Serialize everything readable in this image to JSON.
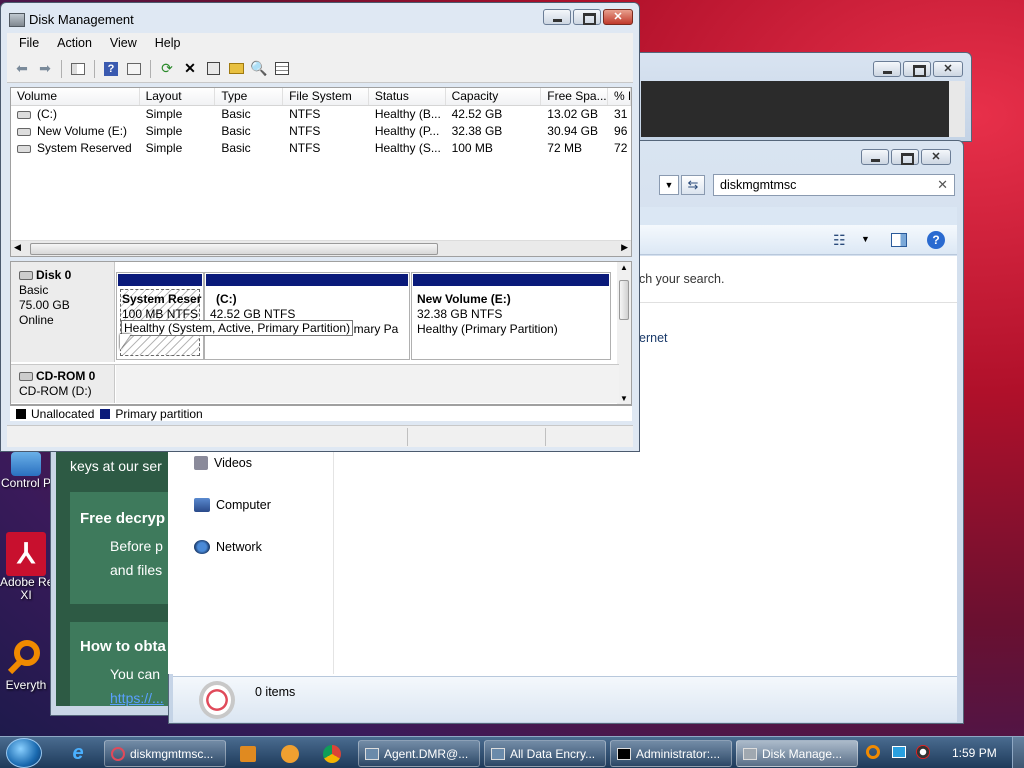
{
  "disk_mgmt": {
    "title": "Disk Management",
    "menu": [
      "File",
      "Action",
      "View",
      "Help"
    ],
    "columns": [
      "Volume",
      "Layout",
      "Type",
      "File System",
      "Status",
      "Capacity",
      "Free Spa...",
      "% F"
    ],
    "rows": [
      [
        "(C:)",
        "Simple",
        "Basic",
        "NTFS",
        "Healthy (B...",
        "42.52 GB",
        "13.02 GB",
        "31"
      ],
      [
        "New Volume (E:)",
        "Simple",
        "Basic",
        "NTFS",
        "Healthy (P...",
        "32.38 GB",
        "30.94 GB",
        "96"
      ],
      [
        "System Reserved",
        "Simple",
        "Basic",
        "NTFS",
        "Healthy (S...",
        "100 MB",
        "72 MB",
        "72"
      ]
    ],
    "disk0": {
      "name": "Disk 0",
      "type": "Basic",
      "size": "75.00 GB",
      "state": "Online"
    },
    "partitions": [
      {
        "name": "System Reser",
        "size": "100 MB NTFS",
        "status": ""
      },
      {
        "name": "(C:)",
        "size": "42.52 GB NTFS",
        "status": "rimary Pa"
      },
      {
        "name": "New Volume  (E:)",
        "size": "32.38 GB NTFS",
        "status": "Healthy (Primary Partition)"
      }
    ],
    "tooltip": "Healthy (System, Active, Primary Partition)",
    "cdrom": {
      "name": "CD-ROM 0",
      "drive": "CD-ROM (D:)"
    },
    "legend": {
      "unallocated": "Unallocated",
      "primary": "Primary partition"
    },
    "colors": {
      "primary": "#0a1a7a",
      "unallocated": "#000000"
    }
  },
  "explorer": {
    "search_value": "diskmgmtmsc",
    "no_match": "ch your search.",
    "internet": "ernet",
    "nav": [
      "Videos",
      "Computer",
      "Network"
    ],
    "item_count": "0 items"
  },
  "browser_bg": {
    "line1": "keys at our ser",
    "box1_title": "Free decryp",
    "box1_l1": "Before p",
    "box1_l2": "and files",
    "box2_title": "How to obta",
    "box2_l1": "You can",
    "box2_link": "https://..."
  },
  "desktop": {
    "icons": [
      "Control P",
      "Adobe Re\nXI",
      "Everyth"
    ]
  },
  "taskbar": {
    "buttons": [
      "diskmgmtmsc...",
      "Agent.DMR@...",
      "All Data Encry...",
      "Administrator:...",
      "Disk Manage..."
    ],
    "clock": "1:59 PM"
  }
}
